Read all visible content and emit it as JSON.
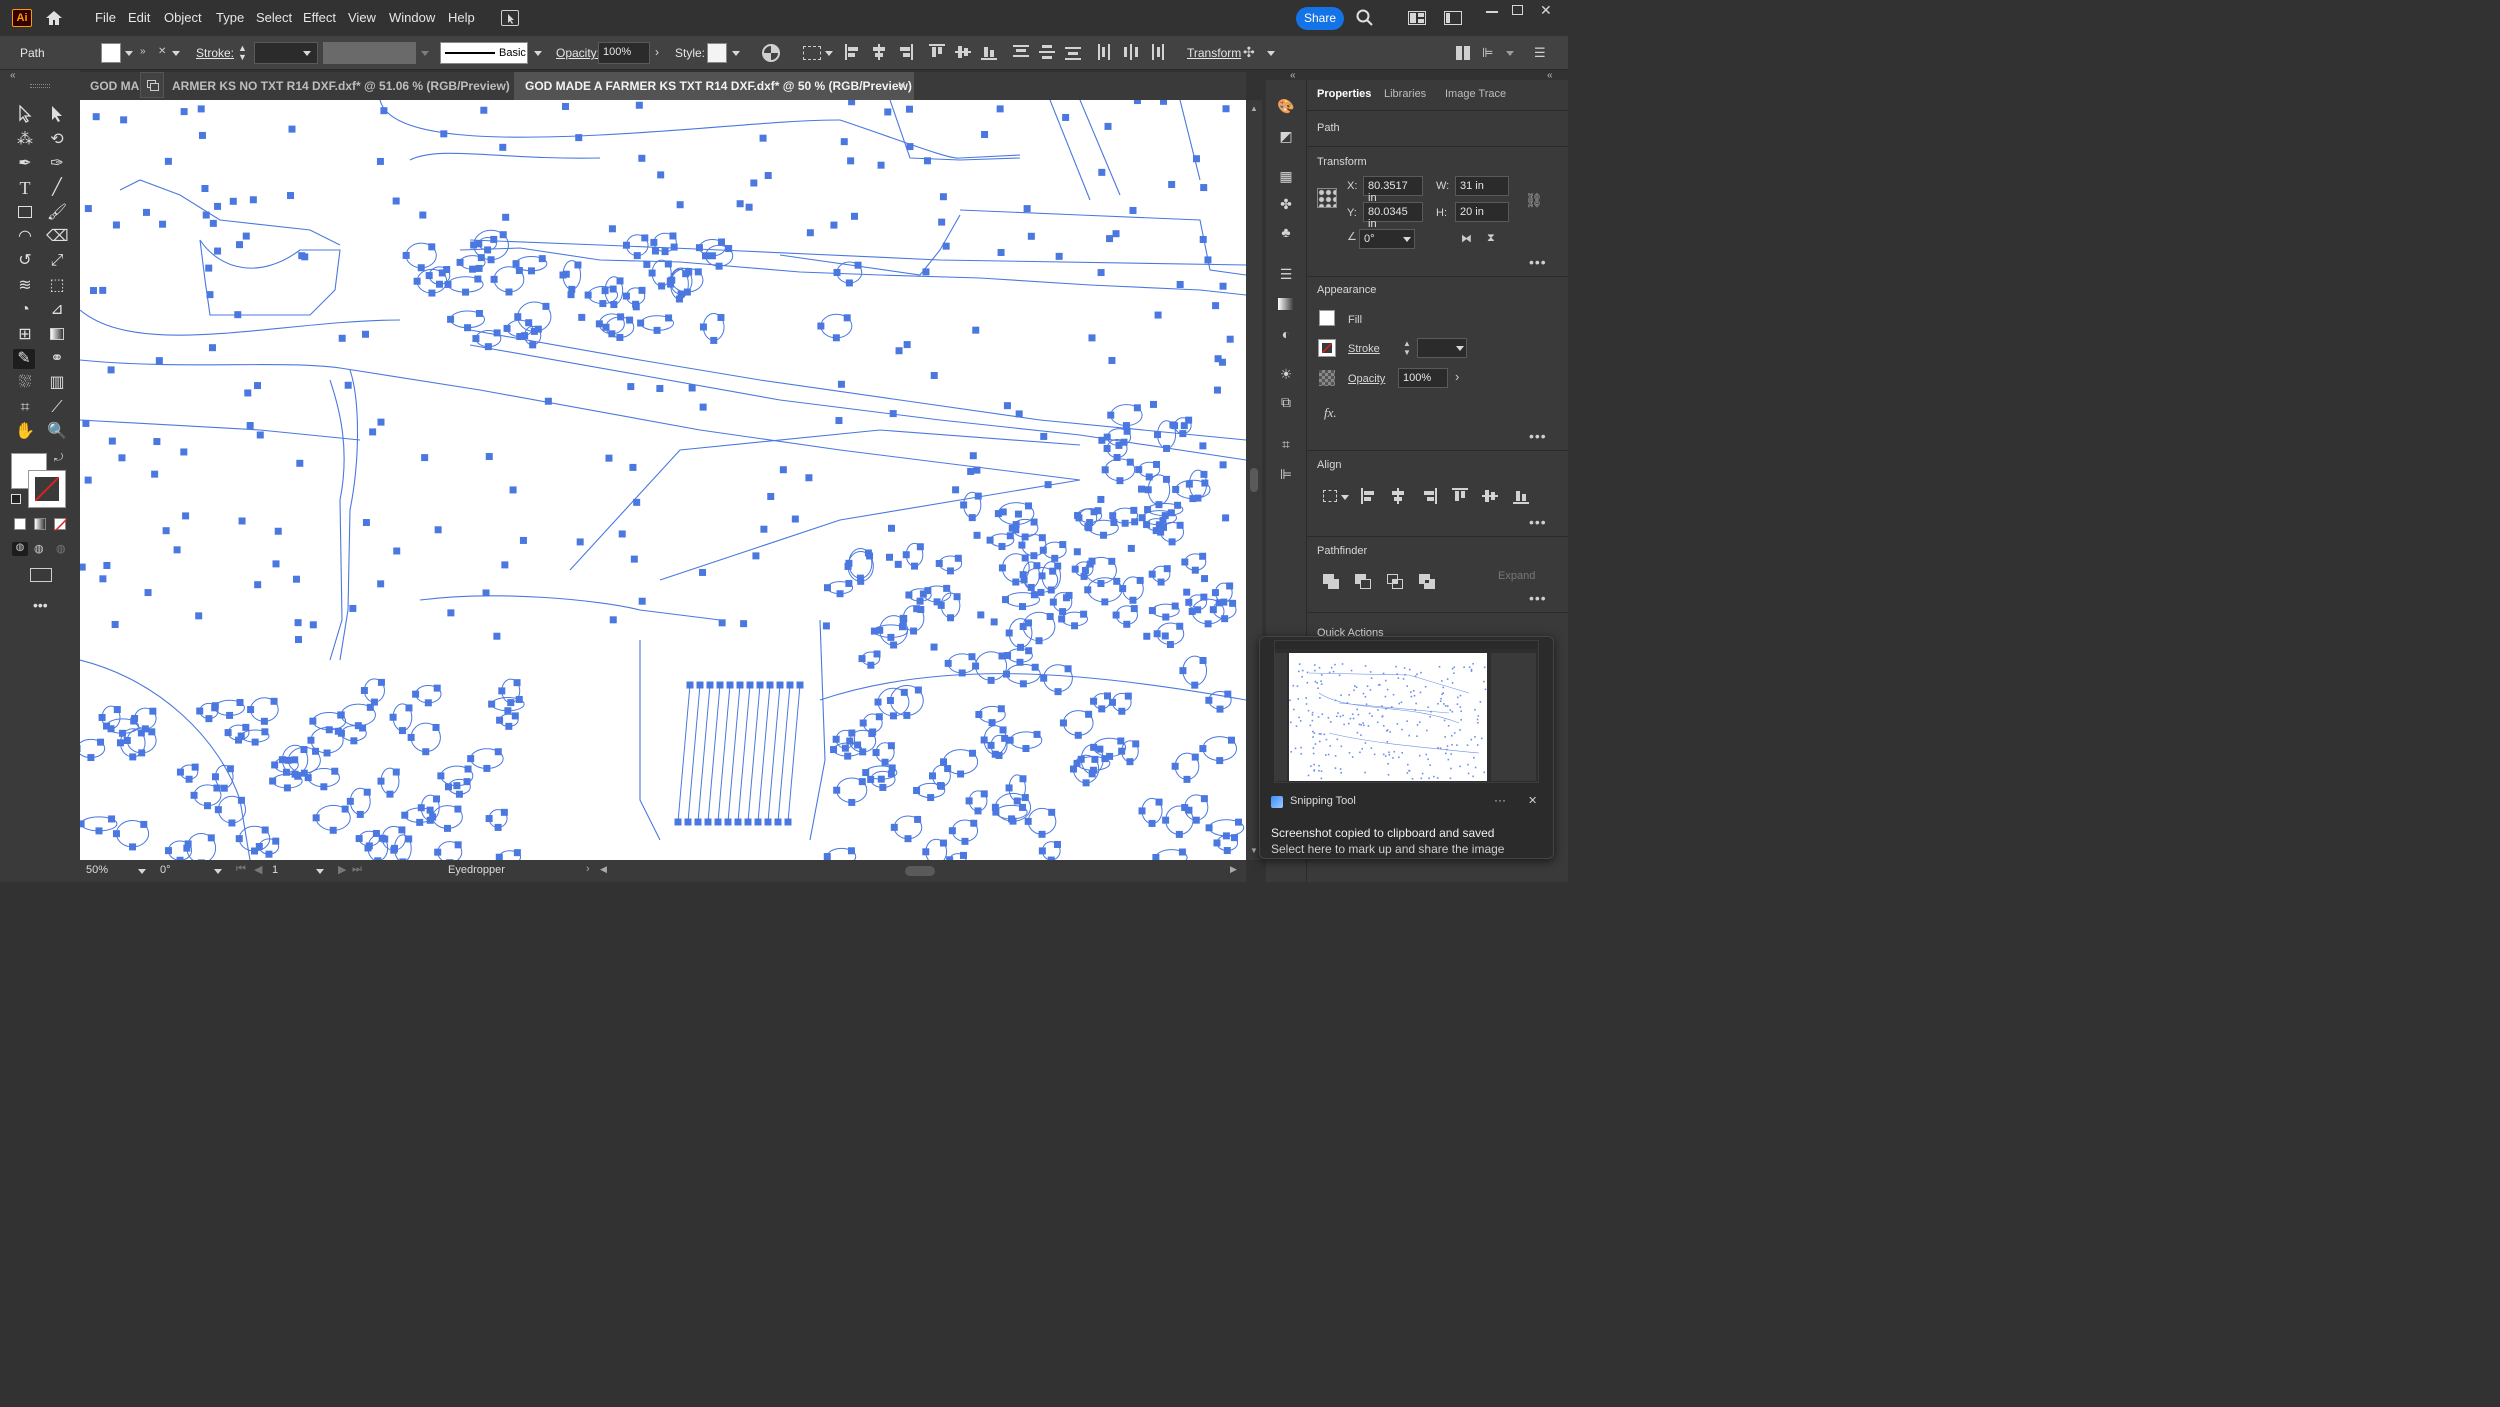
{
  "app": {
    "logo": "Ai"
  },
  "menu": [
    "File",
    "Edit",
    "Object",
    "Type",
    "Select",
    "Effect",
    "View",
    "Window",
    "Help"
  ],
  "share_label": "Share",
  "control_bar": {
    "selection_type": "Path",
    "stroke_label": "Stroke:",
    "brush_label": "Basic",
    "opacity_label": "Opacity:",
    "opacity_value": "100%",
    "style_label": "Style:",
    "transform_label": "Transform"
  },
  "tabs": [
    {
      "label": "GOD MADE A FARMER KS NO TXT R14 DXF.dxf* @ 51.06 % (RGB/Preview)"
    },
    {
      "label": "GOD MADE A FARMER KS TXT R14 DXF.dxf* @ 50 % (RGB/Preview)",
      "active": true
    }
  ],
  "tab_collapsed_text": "GOD MA",
  "tab_partial_text": "ARMER KS NO TXT R14 DXF.dxf* @ 51.06 % (RGB/Preview)",
  "status": {
    "zoom": "50%",
    "rotation": "0°",
    "artboard": "1",
    "tool": "Eyedropper"
  },
  "panel": {
    "tabs": [
      "Properties",
      "Libraries",
      "Image Trace"
    ],
    "selection": "Path",
    "transform_title": "Transform",
    "x_label": "X:",
    "x_value": "80.3517 in",
    "y_label": "Y:",
    "y_value": "80.0345 in",
    "w_label": "W:",
    "w_value": "31 in",
    "h_label": "H:",
    "h_value": "20 in",
    "angle_value": "0°",
    "appearance_title": "Appearance",
    "fill_label": "Fill",
    "stroke_label": "Stroke",
    "opacity_label": "Opacity",
    "opacity_value": "100%",
    "fx_label": "fx.",
    "align_title": "Align",
    "pathfinder_title": "Pathfinder",
    "expand_label": "Expand",
    "quick_actions_title": "Quick Actions"
  },
  "toast": {
    "app_name": "Snipping Tool",
    "line1": "Screenshot copied to clipboard and saved",
    "line2": "Select here to mark up and share the image",
    "more": "···",
    "close": "✕"
  },
  "colors": {
    "path_blue": "#4a78e0",
    "accent": "#1473e6"
  }
}
